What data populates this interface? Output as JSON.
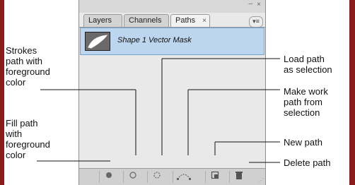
{
  "panel": {
    "tabs": [
      {
        "label": "Layers"
      },
      {
        "label": "Channels"
      },
      {
        "label": "Paths",
        "close": "×"
      }
    ],
    "menu_glyph": "▾≡",
    "collapse_glyph": "–",
    "close_glyph": "×",
    "path_item": {
      "name": "Shape 1 Vector Mask"
    }
  },
  "bottom_buttons": [
    {
      "icon": "fill-path-icon",
      "glyph": "●"
    },
    {
      "icon": "stroke-path-icon",
      "glyph": "○"
    },
    {
      "icon": "load-selection-icon",
      "glyph": "◌"
    },
    {
      "icon": "make-work-path-icon",
      "glyph": "⌒"
    },
    {
      "icon": "new-path-icon",
      "glyph": "◫"
    },
    {
      "icon": "trash-icon",
      "glyph": "🗑"
    }
  ],
  "callouts": {
    "strokes": {
      "lines": [
        "Strokes",
        "path with",
        "foreground",
        "color"
      ]
    },
    "fill": {
      "lines": [
        "Fill path",
        "with",
        "foreground",
        "color"
      ]
    },
    "load": {
      "lines": [
        "Load path",
        "as selection"
      ]
    },
    "make_work": {
      "lines": [
        "Make work",
        "path from",
        "selection"
      ]
    },
    "new_path": {
      "lines": [
        "New path"
      ]
    },
    "delete_path": {
      "lines": [
        "Delete path"
      ]
    }
  },
  "colors": {
    "frame": "#8b1a1a",
    "selection": "#bcd6f0"
  }
}
